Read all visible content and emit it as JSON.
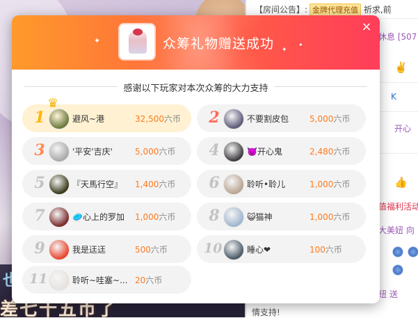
{
  "modal": {
    "title": "众筹礼物赠送成功",
    "close_label": "×",
    "thanks_text": "感谢以下玩家对本次众筹的大力支持",
    "crown_icon": "crown-icon",
    "contributors": [
      {
        "rank": "1",
        "name": "避风~港",
        "amount": "32,500",
        "unit": "六币",
        "avatar_color": "#6b7a3a"
      },
      {
        "rank": "2",
        "name": "不要割皮包",
        "amount": "5,000",
        "unit": "六币",
        "avatar_color": "#5d5a7a"
      },
      {
        "rank": "3",
        "name": "'平安'吉庆'",
        "amount": "5,000",
        "unit": "六币",
        "avatar_color": "#a9a9a9"
      },
      {
        "rank": "4",
        "name": "👿开心鬼",
        "amount": "2,480",
        "unit": "六币",
        "avatar_color": "#3d3a3d"
      },
      {
        "rank": "5",
        "name": "『天馬行空』",
        "amount": "1,400",
        "unit": "六币",
        "avatar_color": "#3a3a1a"
      },
      {
        "rank": "6",
        "name": "聆听•聆儿",
        "amount": "1,000",
        "unit": "六币",
        "avatar_color": "#b9a592"
      },
      {
        "rank": "7",
        "name": "🥏心上的罗加",
        "amount": "1,000",
        "unit": "六币",
        "avatar_color": "#7a2b2b"
      },
      {
        "rank": "8",
        "name": "😺猫神",
        "amount": "1,000",
        "unit": "六币",
        "avatar_color": "#9fb5cf"
      },
      {
        "rank": "9",
        "name": "我是迋迋",
        "amount": "500",
        "unit": "六币",
        "avatar_color": "#e8452d"
      },
      {
        "rank": "10",
        "name": "睡心❤",
        "amount": "100",
        "unit": "六币",
        "avatar_color": "#4a5a66"
      },
      {
        "rank": "11",
        "name": "聆听~哇塞~...",
        "amount": "20",
        "unit": "六币",
        "avatar_color": "#e7e2de"
      }
    ]
  },
  "chat": {
    "notice_label": "【房间公告】:",
    "notice_badge": "金牌代理充值",
    "notice_rest": "祈求,前",
    "line_xiuxi": "休息 [507",
    "line_kaixin": "开心",
    "line_fuli": "值福利活动",
    "line_meiniu": "大美妞 向",
    "line_niuzhi": "纽 送",
    "line_zhichi": "情支持!"
  },
  "stream": {
    "caption": "差七十五币了",
    "caption2": "也"
  }
}
